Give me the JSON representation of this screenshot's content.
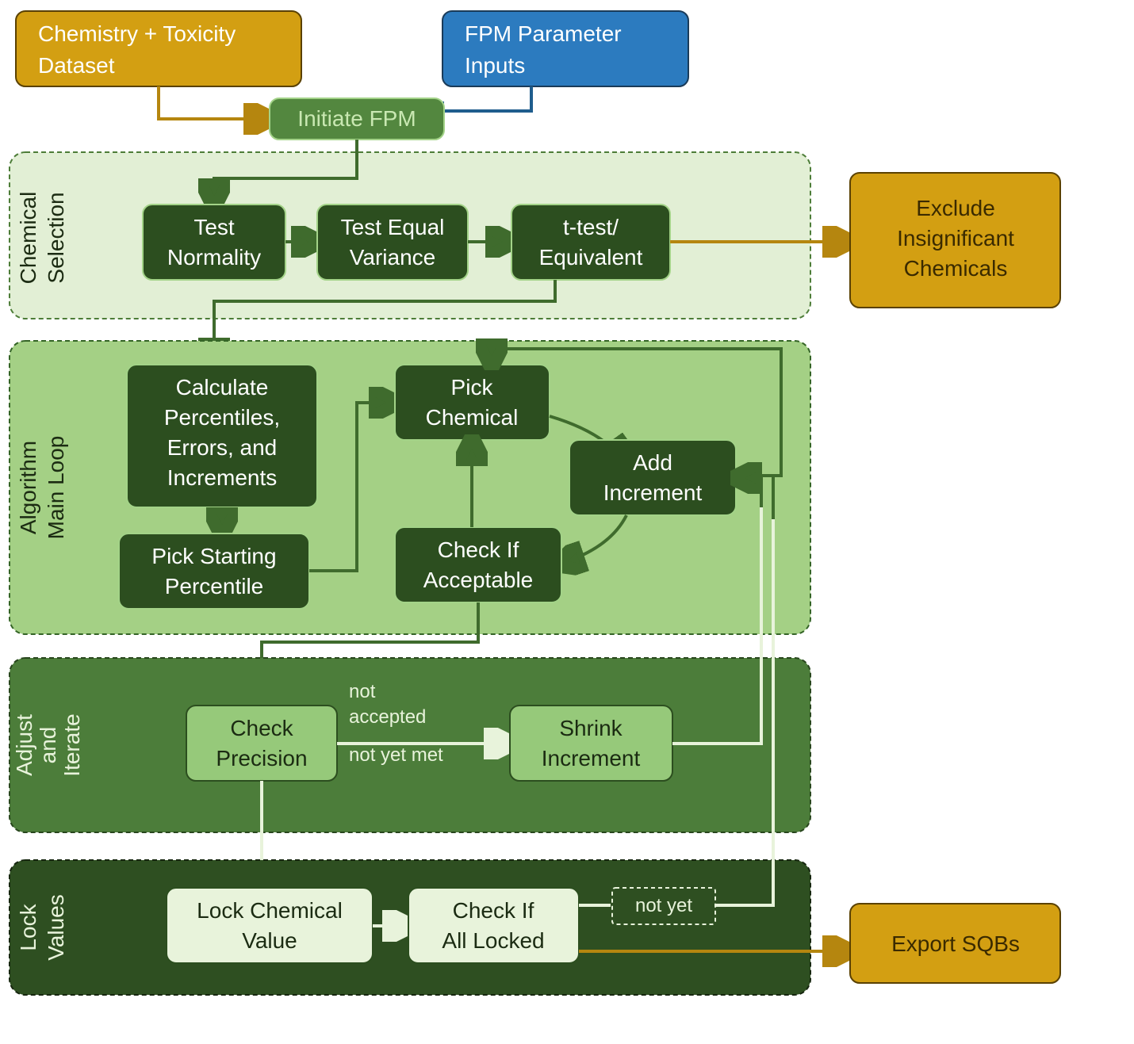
{
  "inputs": {
    "dataset_l1": "Chemistry + Toxicity",
    "dataset_l2": "Dataset",
    "params_l1": "FPM Parameter",
    "params_l2": "Inputs"
  },
  "initiate": "Initiate FPM",
  "panels": {
    "chemical_l1": "Chemical",
    "chemical_l2": "Selection",
    "mainloop_l1": "Algorithm",
    "mainloop_l2": "Main Loop",
    "adjust_l1": "Adjust",
    "adjust_l2": "and",
    "adjust_l3": "Iterate",
    "lock_l1": "Lock",
    "lock_l2": "Values"
  },
  "chem": {
    "normality_l1": "Test",
    "normality_l2": "Normality",
    "variance_l1": "Test Equal",
    "variance_l2": "Variance",
    "ttest_l1": "t-test/",
    "ttest_l2": "Equivalent",
    "exclude_l1": "Exclude",
    "exclude_l2": "Insignificant",
    "exclude_l3": "Chemicals"
  },
  "loop": {
    "calc_l1": "Calculate",
    "calc_l2": "Percentiles,",
    "calc_l3": "Errors, and",
    "calc_l4": "Increments",
    "start_l1": "Pick Starting",
    "start_l2": "Percentile",
    "pick_l1": "Pick",
    "pick_l2": "Chemical",
    "add_l1": "Add",
    "add_l2": "Increment",
    "check_l1": "Check If",
    "check_l2": "Acceptable"
  },
  "adjust": {
    "prec_l1": "Check",
    "prec_l2": "Precision",
    "shrink_l1": "Shrink",
    "shrink_l2": "Increment",
    "not_accepted": "not",
    "not_accepted2": "accepted",
    "not_met": "not yet met"
  },
  "lock": {
    "lockval_l1": "Lock Chemical",
    "lockval_l2": "Value",
    "checkall_l1": "Check If",
    "checkall_l2": "All Locked",
    "not_yet": "not yet",
    "export": "Export SQBs"
  }
}
